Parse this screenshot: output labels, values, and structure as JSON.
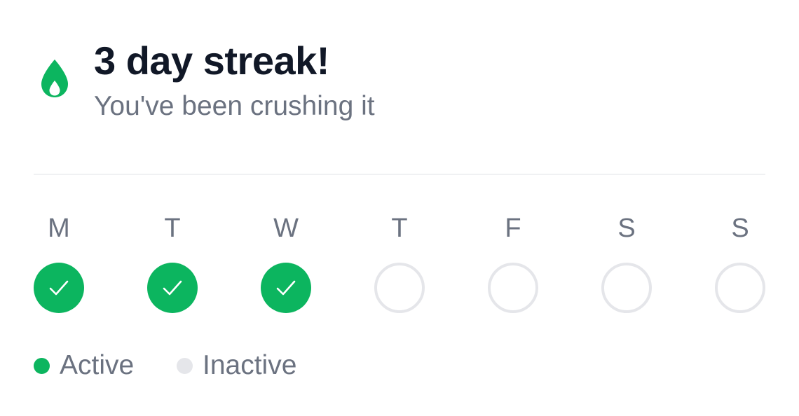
{
  "header": {
    "title": "3 day streak!",
    "subtitle": "You've been crushing it",
    "icon": "flame-icon"
  },
  "week": {
    "days": [
      {
        "label": "M",
        "active": true
      },
      {
        "label": "T",
        "active": true
      },
      {
        "label": "W",
        "active": true
      },
      {
        "label": "T",
        "active": false
      },
      {
        "label": "F",
        "active": false
      },
      {
        "label": "S",
        "active": false
      },
      {
        "label": "S",
        "active": false
      }
    ]
  },
  "legend": {
    "active_label": "Active",
    "inactive_label": "Inactive"
  },
  "colors": {
    "accent": "#0cb55f",
    "inactive": "#e5e6ea",
    "title": "#111827",
    "muted": "#6b7280"
  }
}
